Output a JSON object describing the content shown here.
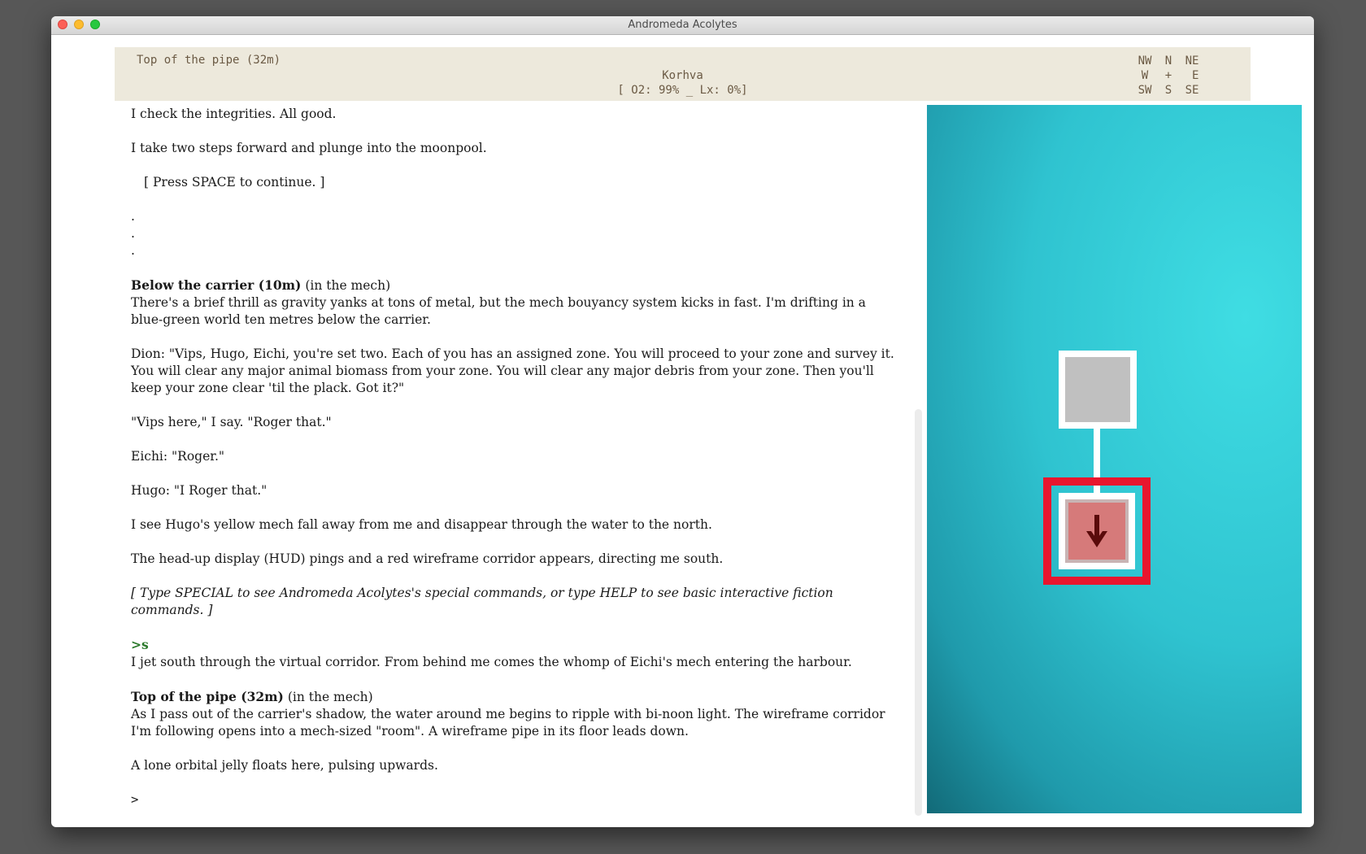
{
  "window": {
    "title": "Andromeda Acolytes"
  },
  "status": {
    "location": "Top of the pipe (32m)",
    "region": "Korhva",
    "readout": "[ O2: 99% _ Lx:  0%]",
    "compass": [
      "NW",
      "N",
      "NE",
      "W",
      "+",
      " E",
      "SW",
      "S",
      "SE"
    ]
  },
  "story": {
    "p1": "I check the integrities. All good.",
    "p2": "I take two steps forward and plunge into the moonpool.",
    "p3": "[ Press SPACE to continue. ]",
    "dots": [
      ".",
      ".",
      "."
    ],
    "p4_heading": "Below the carrier (10m)",
    "p4_suffix": " (in the mech)",
    "p4_body": "There's a brief thrill as gravity yanks at tons of metal, but the mech bouyancy system kicks in fast. I'm drifting in a blue-green world ten metres below the carrier.",
    "p5": "Dion: \"Vips, Hugo, Eichi, you're set two. Each of you has an assigned zone. You will proceed to your zone and survey it. You will clear any major animal biomass from your zone. You will clear any major debris from your zone. Then you'll keep your zone clear 'til the plack. Got it?\"",
    "p6": "\"Vips here,\" I say. \"Roger that.\"",
    "p7": "Eichi: \"Roger.\"",
    "p8": "Hugo: \"I Roger that.\"",
    "p9": "I see Hugo's yellow mech fall away from me and disappear through the water to the north.",
    "p10": "The head-up display (HUD) pings and a red wireframe corridor appears, directing me south.",
    "p11": "[ Type SPECIAL to see Andromeda Acolytes's special commands, or type HELP to see basic interactive fiction commands. ]",
    "cmd": ">s",
    "p12": "I jet south through the virtual corridor. From behind me comes the whomp of Eichi's mech entering the harbour.",
    "p13_heading": "Top of the pipe (32m)",
    "p13_suffix": " (in the mech)",
    "p13_body": "As I pass out of the carrier's shadow, the water around me begins to ripple with bi-noon light. The wireframe corridor I'm following opens into a mech-sized \"room\". A wireframe pipe in its floor leads down.",
    "p14": "A lone orbital jelly floats here, pulsing upwards.",
    "prompt": ">"
  },
  "map": {
    "current_room_icon": "down-arrow-icon",
    "highlight_color": "#e8162e"
  }
}
